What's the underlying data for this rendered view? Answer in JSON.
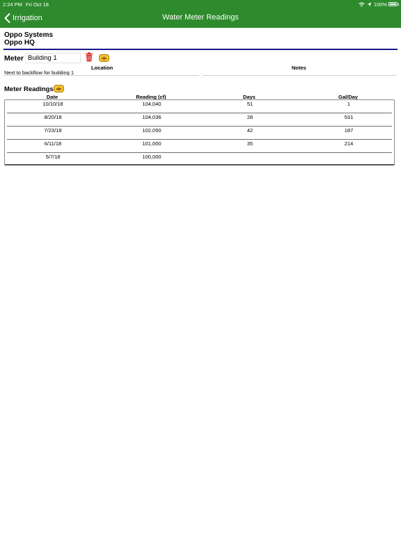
{
  "status_bar": {
    "time": "2:24 PM",
    "date": "Fri Oct 18",
    "battery": "100%"
  },
  "nav": {
    "back_label": "Irrigation",
    "title": "Water Meter Readings"
  },
  "company": {
    "line1": "Oppo Systems",
    "line2": "Oppo HQ"
  },
  "meter": {
    "label": "Meter",
    "name": "Building 1",
    "location_label": "Location",
    "notes_label": "Notes",
    "location_value": "Next to backflow for building 1",
    "notes_value": ""
  },
  "readings": {
    "label": "Meter Readings",
    "columns": [
      "Date",
      "Reading (cf)",
      "Days",
      "Gal/Day"
    ],
    "rows": [
      {
        "date": "10/10/18",
        "reading": "104,040",
        "days": "51",
        "gal_day": "1"
      },
      {
        "date": "8/20/18",
        "reading": "104,036",
        "days": "28",
        "gal_day": "531"
      },
      {
        "date": "7/23/18",
        "reading": "102,050",
        "days": "42",
        "gal_day": "187"
      },
      {
        "date": "6/11/18",
        "reading": "101,000",
        "days": "35",
        "gal_day": "214"
      },
      {
        "date": "5/7/18",
        "reading": "100,000",
        "days": "",
        "gal_day": ""
      }
    ]
  },
  "colors": {
    "header_bg": "#2d8a2d",
    "divider": "#1a1a8a",
    "delete_icon": "#e02020",
    "add_button": "#f6c130"
  }
}
